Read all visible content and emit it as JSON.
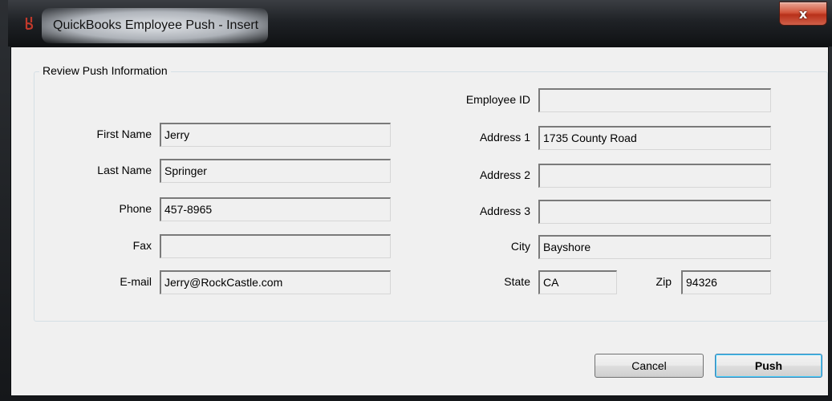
{
  "window": {
    "title": "QuickBooks Employee Push - Insert",
    "close_glyph": "x"
  },
  "group": {
    "legend": "Review Push Information"
  },
  "form": {
    "employee_id": {
      "label": "Employee ID",
      "value": ""
    },
    "first_name": {
      "label": "First Name",
      "value": "Jerry"
    },
    "last_name": {
      "label": "Last Name",
      "value": "Springer"
    },
    "phone": {
      "label": "Phone",
      "value": "457-8965"
    },
    "fax": {
      "label": "Fax",
      "value": ""
    },
    "email": {
      "label": "E-mail",
      "value": "Jerry@RockCastle.com"
    },
    "address1": {
      "label": "Address 1",
      "value": "1735 County Road"
    },
    "address2": {
      "label": "Address 2",
      "value": ""
    },
    "address3": {
      "label": "Address 3",
      "value": ""
    },
    "city": {
      "label": "City",
      "value": "Bayshore"
    },
    "state": {
      "label": "State",
      "value": "CA"
    },
    "zip": {
      "label": "Zip",
      "value": "94326"
    }
  },
  "buttons": {
    "cancel": "Cancel",
    "push": "Push"
  },
  "icons": {
    "app": "quickbooks-app-icon",
    "close": "close-icon"
  },
  "colors": {
    "close_button": "#c8442c",
    "default_button_border": "#3c7fb1"
  }
}
